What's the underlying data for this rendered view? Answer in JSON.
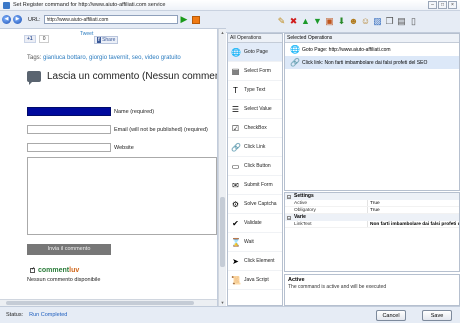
{
  "window": {
    "title": "Set Register command for http://www.aiuto-affiliati.com service"
  },
  "browser": {
    "url_label": "URL:",
    "url_value": "http://www.aiuto-affiliati.com"
  },
  "page": {
    "like_count": "0",
    "tweet_label": "Tweet",
    "share_label": "Share",
    "tags_label": "Tags:",
    "tags": "gianluca bottaro, giorgio tavernit, seo, video gratuito",
    "comment_heading": "Lascia un commento (Nessun commento f",
    "name_label": "Name (required)",
    "email_label": "Email (will not be published) (required)",
    "website_label": "Website",
    "submit_label": "Invia il commento",
    "commentluv_a": "comment",
    "commentluv_b": "luv",
    "no_comments": "Nessun commento disponibile"
  },
  "operations": {
    "header": "All Operations",
    "items": [
      {
        "label": "Goto Page",
        "icon": "globe-icon",
        "glyph": "🌐"
      },
      {
        "label": "Select Form",
        "icon": "form-icon",
        "glyph": "▤"
      },
      {
        "label": "Type Text",
        "icon": "text-icon",
        "glyph": "T"
      },
      {
        "label": "Select Value",
        "icon": "list-icon",
        "glyph": "☰"
      },
      {
        "label": "CheckBox",
        "icon": "checkbox-icon",
        "glyph": "☑"
      },
      {
        "label": "Click Link",
        "icon": "link-icon",
        "glyph": "🔗"
      },
      {
        "label": "Click Button",
        "icon": "button-icon",
        "glyph": "▭"
      },
      {
        "label": "Submit Form",
        "icon": "submit-icon",
        "glyph": "✉"
      },
      {
        "label": "Solve Captcha",
        "icon": "captcha-icon",
        "glyph": "⚙"
      },
      {
        "label": "Validate",
        "icon": "validate-icon",
        "glyph": "✔"
      },
      {
        "label": "Wait",
        "icon": "hourglass-icon",
        "glyph": "⌛"
      },
      {
        "label": "Click Element",
        "icon": "cursor-icon",
        "glyph": "➤"
      },
      {
        "label": "Java Script",
        "icon": "script-icon",
        "glyph": "📜"
      }
    ]
  },
  "selected_ops": {
    "header": "Selected Operations",
    "items": [
      {
        "label": "Goto Page: http://www.aiuto-affiliati.com",
        "glyph": "🌐"
      },
      {
        "label": "Click link: Non farti imbambolare dai falsi profeti del SEO",
        "glyph": "🔗"
      }
    ]
  },
  "properties": {
    "settings_label": "Settings",
    "active_name": "Active",
    "active_value": "True",
    "obligatory_name": "Obligatory",
    "obligatory_value": "True",
    "misc_label": "Varie",
    "linktext_name": "LinkText",
    "linktext_value": "Non farti imbambolare dai falsi profeti del SEO"
  },
  "description": {
    "title": "Active",
    "text": "The command is active and will be executed"
  },
  "status": {
    "label": "Status:",
    "value": "Run Completed"
  },
  "buttons": {
    "cancel": "Cancel",
    "save": "Save"
  }
}
